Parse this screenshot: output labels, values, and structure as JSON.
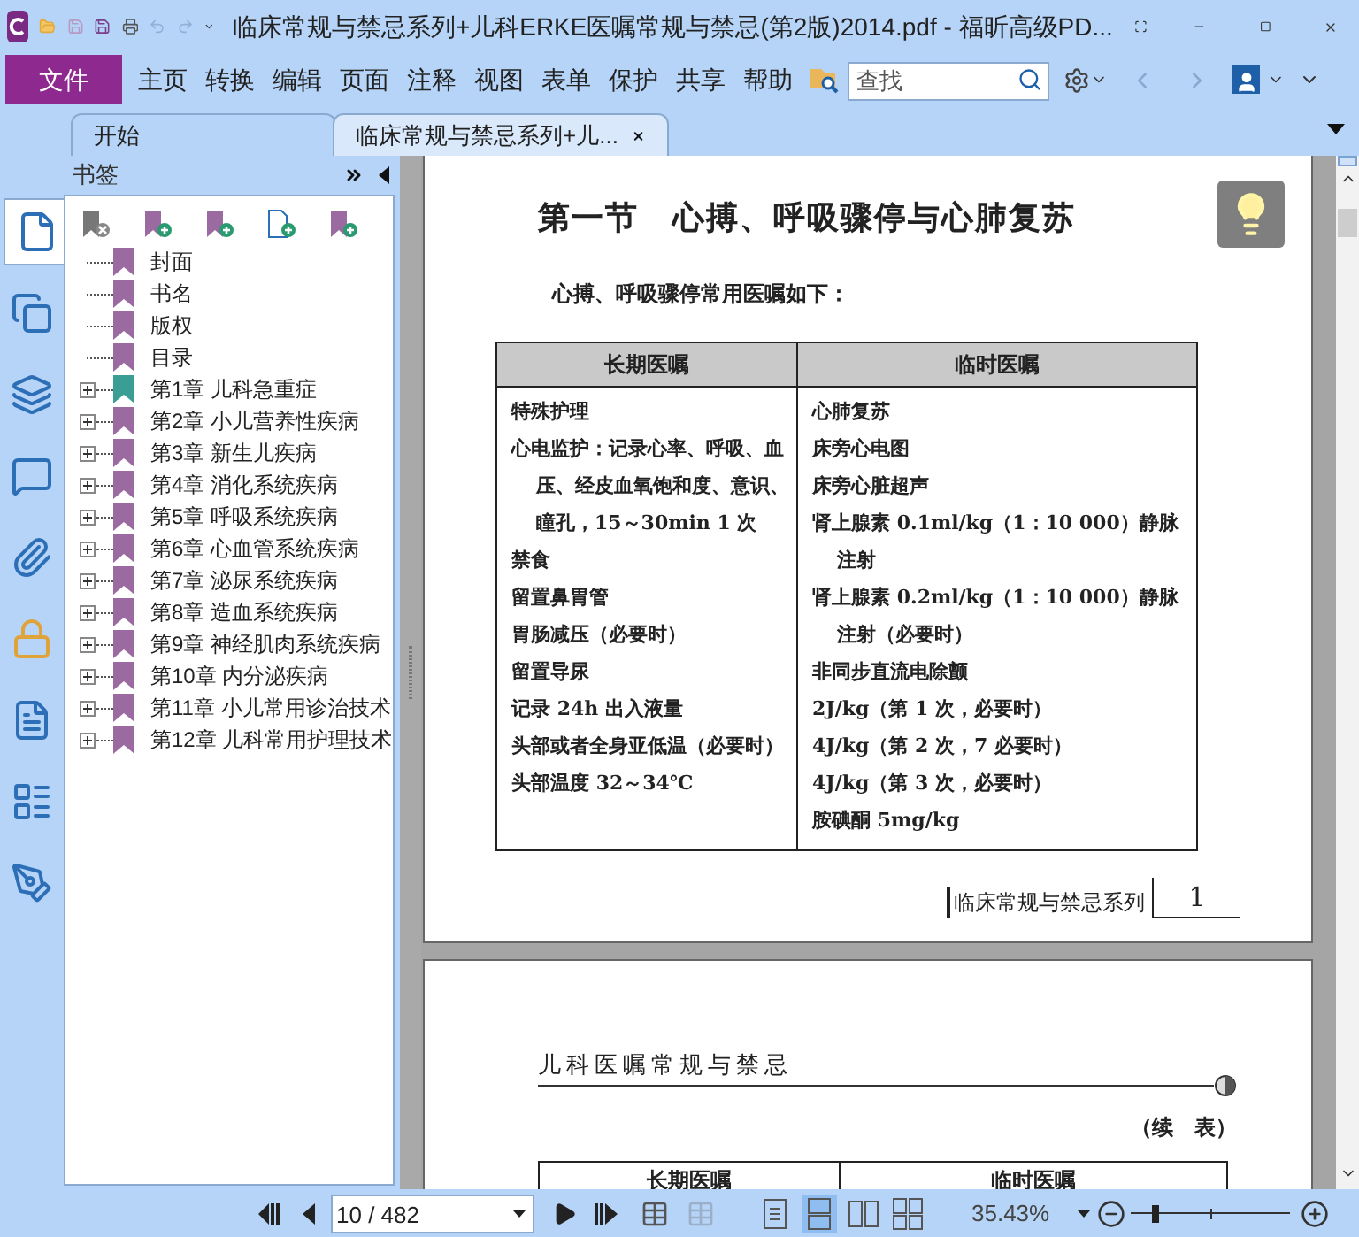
{
  "window": {
    "title": "临床常规与禁忌系列+儿科ERKE医嘱常规与禁忌(第2版)2014.pdf - 福昕高级PD..."
  },
  "menu": {
    "file": "文件",
    "items": [
      "主页",
      "转换",
      "编辑",
      "页面",
      "注释",
      "视图",
      "表单",
      "保护",
      "共享",
      "帮助"
    ],
    "search": {
      "placeholder": "查找"
    }
  },
  "tabs": [
    {
      "label": "开始",
      "selected": false,
      "closable": false
    },
    {
      "label": "临床常规与禁忌系列+儿...",
      "selected": true,
      "closable": true
    }
  ],
  "side_tabs": [
    {
      "kind": "page",
      "selected": true
    },
    {
      "kind": "pages",
      "selected": false
    },
    {
      "kind": "layers",
      "selected": false
    },
    {
      "kind": "comments",
      "selected": false
    },
    {
      "kind": "attachments",
      "selected": false
    },
    {
      "kind": "security",
      "selected": false
    },
    {
      "kind": "document",
      "selected": false
    },
    {
      "kind": "form",
      "selected": false
    },
    {
      "kind": "signature",
      "selected": false
    }
  ],
  "bookmarks": {
    "title": "书签",
    "items": [
      {
        "label": "封面",
        "expandable": false,
        "color": "#9b6aa0"
      },
      {
        "label": "书名",
        "expandable": false,
        "color": "#9b6aa0"
      },
      {
        "label": "版权",
        "expandable": false,
        "color": "#9b6aa0"
      },
      {
        "label": "目录",
        "expandable": false,
        "color": "#9b6aa0"
      },
      {
        "label": "第1章 儿科急重症",
        "expandable": true,
        "color": "#3b9e95"
      },
      {
        "label": "第2章 小儿营养性疾病",
        "expandable": true,
        "color": "#9b6aa0"
      },
      {
        "label": "第3章 新生儿疾病",
        "expandable": true,
        "color": "#9b6aa0"
      },
      {
        "label": "第4章 消化系统疾病",
        "expandable": true,
        "color": "#9b6aa0"
      },
      {
        "label": "第5章 呼吸系统疾病",
        "expandable": true,
        "color": "#9b6aa0"
      },
      {
        "label": "第6章 心血管系统疾病",
        "expandable": true,
        "color": "#9b6aa0"
      },
      {
        "label": "第7章 泌尿系统疾病",
        "expandable": true,
        "color": "#9b6aa0"
      },
      {
        "label": "第8章 造血系统疾病",
        "expandable": true,
        "color": "#9b6aa0"
      },
      {
        "label": "第9章 神经肌肉系统疾病",
        "expandable": true,
        "color": "#9b6aa0"
      },
      {
        "label": "第10章 内分泌疾病",
        "expandable": true,
        "color": "#9b6aa0"
      },
      {
        "label": "第11章 小儿常用诊治技术",
        "expandable": true,
        "color": "#9b6aa0"
      },
      {
        "label": "第12章 儿科常用护理技术",
        "expandable": true,
        "color": "#9b6aa0"
      }
    ]
  },
  "page_1": {
    "heading": "第一节　心搏、呼吸骤停与心肺复苏",
    "intro": "心搏、呼吸骤停常用医嘱如下：",
    "columns": [
      "长期医嘱",
      "临时医嘱"
    ],
    "left": [
      "特殊护理",
      "心电监护：记录心率、呼吸、血压、经皮血氧饱和度、意识、瞳孔，15～30min 1 次",
      "禁食",
      "留置鼻胃管",
      "胃肠减压（必要时）",
      "留置导尿",
      "记录 24h 出入液量",
      "头部或者全身亚低温（必要时）",
      "头部温度 32～34℃"
    ],
    "right": [
      "心肺复苏",
      "床旁心电图",
      "床旁心脏超声",
      "肾上腺素 0.1ml/kg（1：10 000）静脉注射",
      "肾上腺素 0.2ml/kg（1：10 000）静脉注射（必要时）",
      "非同步直流电除颤",
      "2J/kg（第 1 次，必要时）",
      "4J/kg（第 2 次，7 必要时）",
      "4J/kg（第 3 次，必要时）",
      "胺碘酮 5mg/kg"
    ],
    "footer": "临床常规与禁忌系列",
    "page_number": "1"
  },
  "page_2": {
    "header": "儿科医嘱常规与禁忌",
    "continued": "（续　表）",
    "columns": [
      "长期医嘱",
      "临时医嘱"
    ]
  },
  "status_bar": {
    "page": "10 / 482",
    "zoom": "35.43%",
    "zoom_slider": {
      "level": 0.15
    },
    "view_modes": [
      {
        "kind": "single",
        "selected": false
      },
      {
        "kind": "continuous",
        "selected": true
      },
      {
        "kind": "facing",
        "selected": false
      },
      {
        "kind": "continuous_facing",
        "selected": false
      }
    ]
  }
}
